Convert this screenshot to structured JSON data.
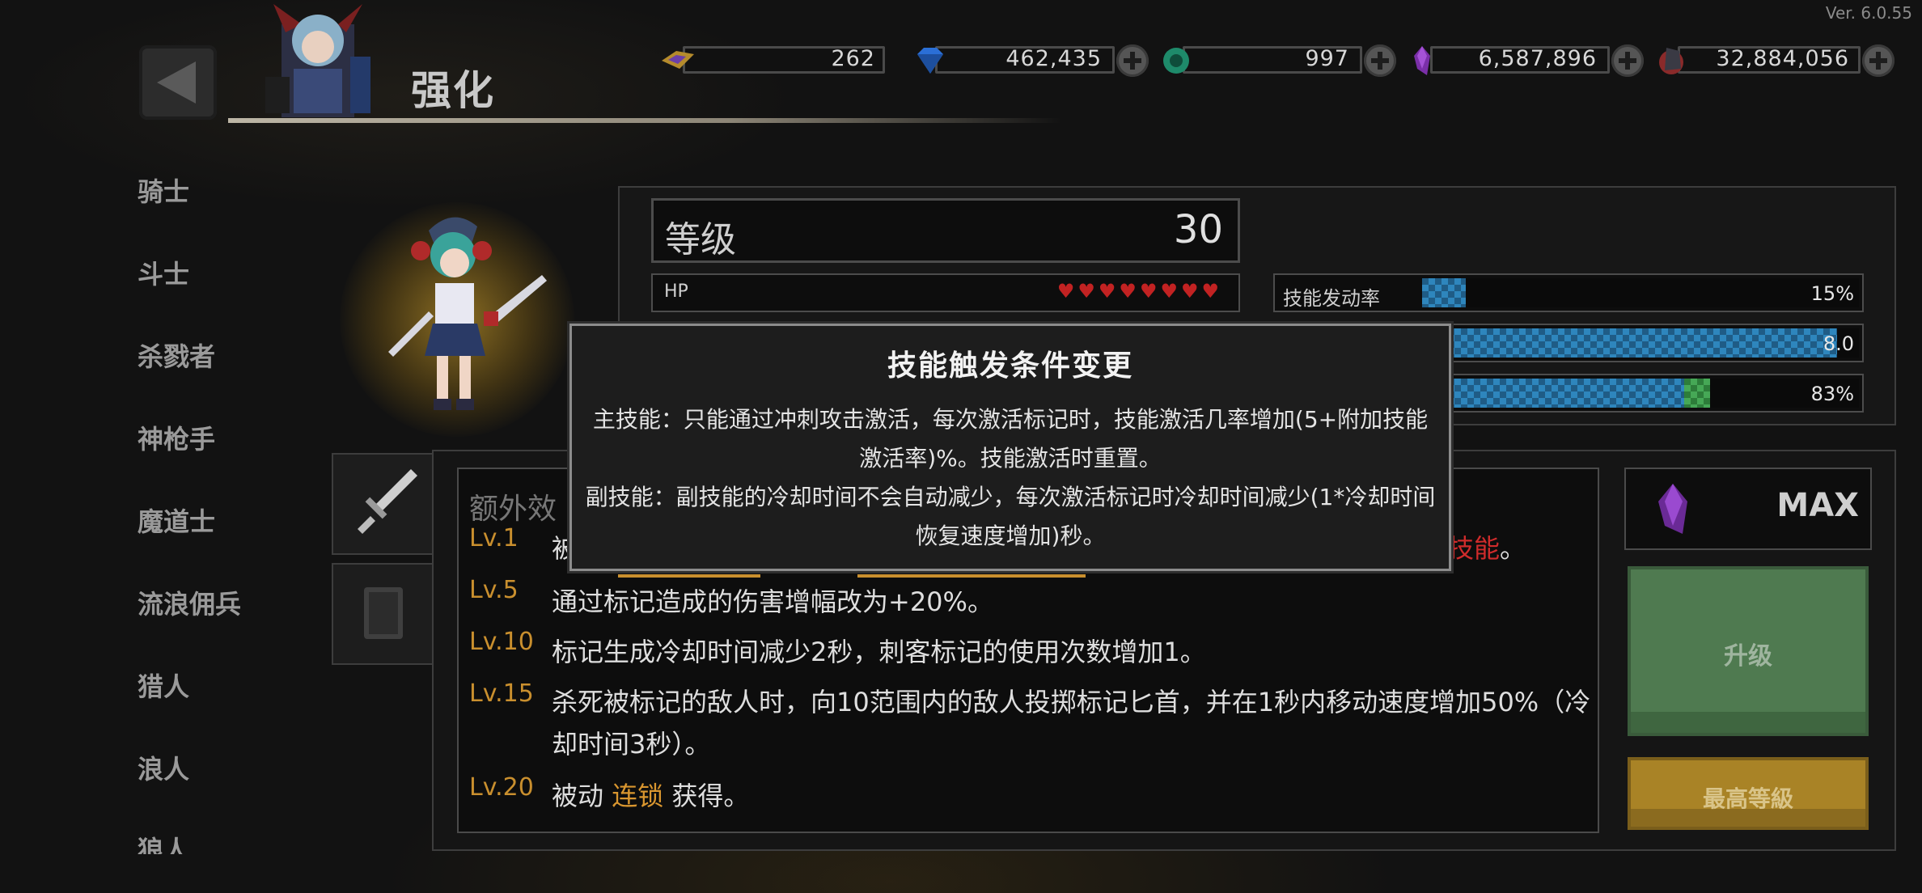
{
  "version": "Ver. 6.0.55",
  "header": {
    "title": "强化"
  },
  "currencies": [
    {
      "icon": "ticket-icon",
      "value": "262",
      "has_plus": false
    },
    {
      "icon": "diamond-icon",
      "value": "462,435",
      "has_plus": true
    },
    {
      "icon": "green-orb-icon",
      "value": "997",
      "has_plus": true
    },
    {
      "icon": "purple-crystal-icon",
      "value": "6,587,896",
      "has_plus": true
    },
    {
      "icon": "dark-ore-icon",
      "value": "32,884,056",
      "has_plus": true
    }
  ],
  "sidebar": {
    "items": [
      {
        "label": "骑士"
      },
      {
        "label": "斗士"
      },
      {
        "label": "杀戮者"
      },
      {
        "label": "神枪手"
      },
      {
        "label": "魔道士"
      },
      {
        "label": "流浪佣兵"
      },
      {
        "label": "猎人"
      },
      {
        "label": "浪人"
      },
      {
        "label": "狼人"
      }
    ]
  },
  "stats": {
    "level_label": "等级",
    "level_value": "30",
    "hp_label": "HP",
    "hp_hearts": "♥♥♥♥♥♥♥♥",
    "rows": [
      {
        "label": "技能发动率",
        "value": "15%",
        "fill": 0.1,
        "fill2": 0
      },
      {
        "label": "",
        "value": "8.0",
        "fill": 0.95,
        "fill2": 0
      },
      {
        "label": "",
        "value": "83%",
        "fill": 0.6,
        "fill2": 0.06
      }
    ]
  },
  "description": {
    "heading": "额外效",
    "entries": [
      {
        "level": "Lv.1",
        "pre": "被",
        "gold": "",
        "post": "",
        "red": "技能",
        "tail": "。"
      },
      {
        "level": "Lv.5",
        "text": "通过标记造成的伤害增幅改为+20%。"
      },
      {
        "level": "Lv.10",
        "text": "标记生成冷却时间减少2秒，刺客标记的使用次数增加1。"
      },
      {
        "level": "Lv.15",
        "text": "杀死被标记的敌人时，向10范围内的敌人投掷标记匕首，并在1秒内移动速度增加50%（冷却时间3秒）。"
      },
      {
        "level": "Lv.20",
        "pre": "被动 ",
        "gold": "连锁",
        "post": " 获得。"
      }
    ]
  },
  "right_panel": {
    "max_label": "MAX",
    "upgrade_label": "升级",
    "max_level_label": "最高等級"
  },
  "tooltip": {
    "title": "技能触发条件变更",
    "line1": "主技能：只能通过冲刺攻击激活，每次激活标记时，技能激活几率增加(5+附加技能激活率)%。技能激活时重置。",
    "line2": "副技能：副技能的冷却时间不会自动减少，每次激活标记时冷却时间减少(1*冷却时间恢复速度增加)秒。"
  }
}
